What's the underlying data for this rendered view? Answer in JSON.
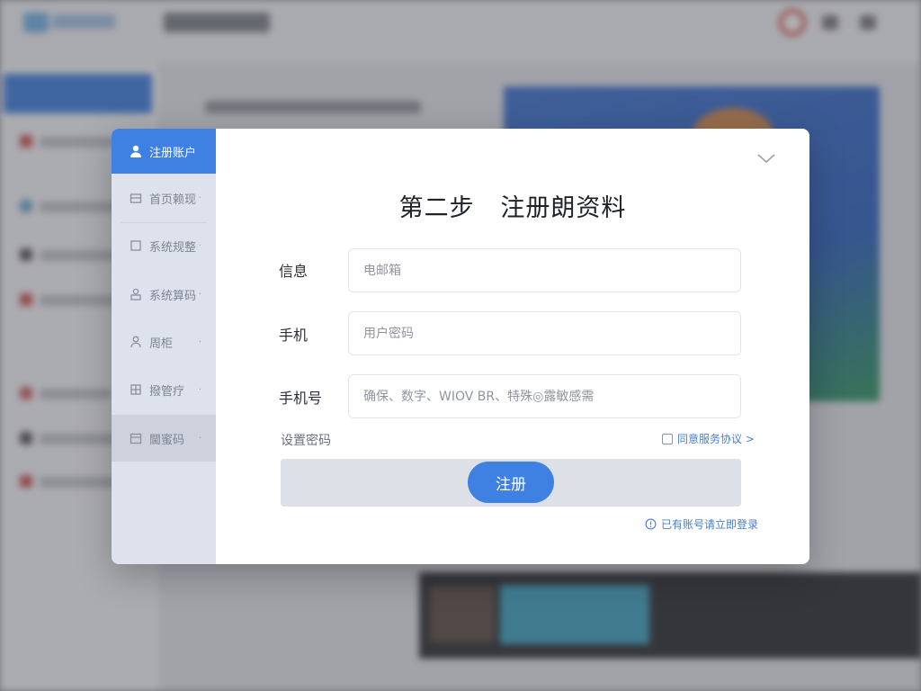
{
  "modal": {
    "title": "第二步   注册朗资料",
    "close_icon": "chevron-down-icon",
    "sidebar": {
      "items": [
        {
          "label": "注册账户",
          "icon": "user-icon",
          "active": true
        },
        {
          "label": "首页赖现",
          "icon": "home-icon"
        },
        {
          "label": "系统规整",
          "icon": "square-icon"
        },
        {
          "label": "系统算码",
          "icon": "settings-icon"
        },
        {
          "label": "周柜",
          "icon": "person-icon"
        },
        {
          "label": "撥管疗",
          "icon": "grid-icon"
        },
        {
          "label": "閫蜜码",
          "icon": "folder-icon"
        }
      ],
      "chevron": "·"
    },
    "form": {
      "info_label": "信息",
      "info_placeholder": "电邮箱",
      "phone_label": "手机",
      "phone_placeholder": "用户密码",
      "phone_number_label": "手机号",
      "phone_number_placeholder": "确保、数字、WIOV BR、特殊◎露敏感需",
      "password_label": "设置密码",
      "agree_text": "同意服务协议 >",
      "submit_label": "注册",
      "footer_link": "已有账号请立即登录"
    }
  },
  "colors": {
    "primary": "#3f80e3",
    "sidebar_bg": "#dee2ec",
    "link": "#4a7fd2"
  }
}
